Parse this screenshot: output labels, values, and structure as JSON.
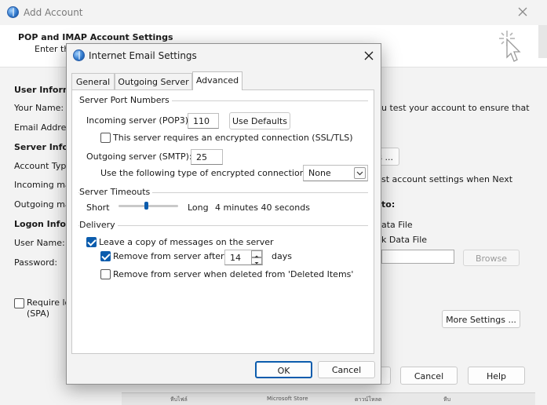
{
  "background_window": {
    "title": "Add Account",
    "header_title": "POP and IMAP Account Settings",
    "header_subtitle": "Enter th",
    "labels": {
      "user_info": "User Informa",
      "your_name": "Your Name:",
      "email_address": "Email Addres",
      "server_info": "Server Inform",
      "account_type": "Account Type",
      "incoming": "Incoming ma",
      "outgoing": "Outgoing ma",
      "logon_info": "Logon Inforr",
      "user_name": "User Name:",
      "password": "Password:",
      "require_line1": "Require lo",
      "require_line2": "(SPA)"
    },
    "right_text": {
      "test_account": "u test your account to ensure that",
      "dots_button": "s ...",
      "next_settings": "st account settings when Next",
      "deliver_to": "to:",
      "data_file": "ata File",
      "k_data_file": "k Data File"
    },
    "browse_label": "Browse",
    "more_settings_label": "More Settings ...",
    "footer": {
      "cancel_label": "Cancel",
      "help_label": "Help"
    },
    "taskbar_items": [
      "หีบไฟล์",
      "Microsoft Store",
      "ดาวน์โหลด",
      "หีบ"
    ]
  },
  "dialog": {
    "title": "Internet Email Settings",
    "tabs": [
      {
        "label": "General",
        "active": false
      },
      {
        "label": "Outgoing Server",
        "active": false
      },
      {
        "label": "Advanced",
        "active": true
      }
    ],
    "ports": {
      "section_title": "Server Port Numbers",
      "incoming_label": "Incoming server (POP3):",
      "incoming_value": "110",
      "use_defaults_label": "Use Defaults",
      "encrypted_label": "This server requires an encrypted connection (SSL/TLS)",
      "encrypted_checked": false,
      "outgoing_label": "Outgoing server (SMTP):",
      "outgoing_value": "25",
      "encryption_type_label": "Use the following type of encrypted connection:",
      "encryption_type_value": "None"
    },
    "timeouts": {
      "section_title": "Server Timeouts",
      "short_label": "Short",
      "long_label": "Long",
      "value_text": "4 minutes 40 seconds",
      "slider_fraction": 0.47
    },
    "delivery": {
      "section_title": "Delivery",
      "leave_copy_label": "Leave a copy of messages on the server",
      "leave_copy_checked": true,
      "remove_after_label": "Remove from server after",
      "remove_after_checked": true,
      "days_value": "14",
      "days_label": "days",
      "remove_deleted_label": "Remove from server when deleted from 'Deleted Items'",
      "remove_deleted_checked": false
    },
    "ok_label": "OK",
    "cancel_label": "Cancel"
  }
}
